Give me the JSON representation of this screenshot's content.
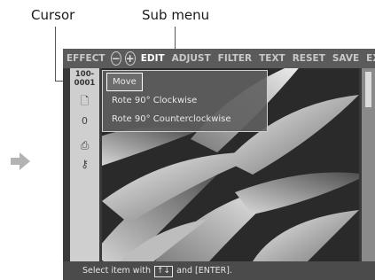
{
  "annotations": {
    "cursor_label": "Cursor",
    "submenu_label": "Sub menu"
  },
  "menubar": {
    "items": [
      "EFFECT",
      "EDIT",
      "ADJUST",
      "FILTER",
      "TEXT",
      "RESET",
      "SAVE",
      "EXIT"
    ],
    "zoom_out_icon": "zoom-out-icon",
    "zoom_in_icon": "zoom-in-icon",
    "active": "EDIT"
  },
  "sidebar": {
    "counter_top": "100-",
    "counter_bottom": "0001",
    "value": "0"
  },
  "submenu": {
    "options": [
      "Move",
      "Rote 90°  Clockwise",
      "Rote 90°  Counterclockwise"
    ],
    "selected_index": 0
  },
  "statusbar": {
    "prefix": "Select item with",
    "keys": "↑↓",
    "suffix": "and [ENTER]."
  },
  "colors": {
    "menubar": "#5b5b5b",
    "statusbar": "#4b4b4b",
    "sidebar": "#cfcfcf",
    "arrow": "#b3b3b3"
  }
}
